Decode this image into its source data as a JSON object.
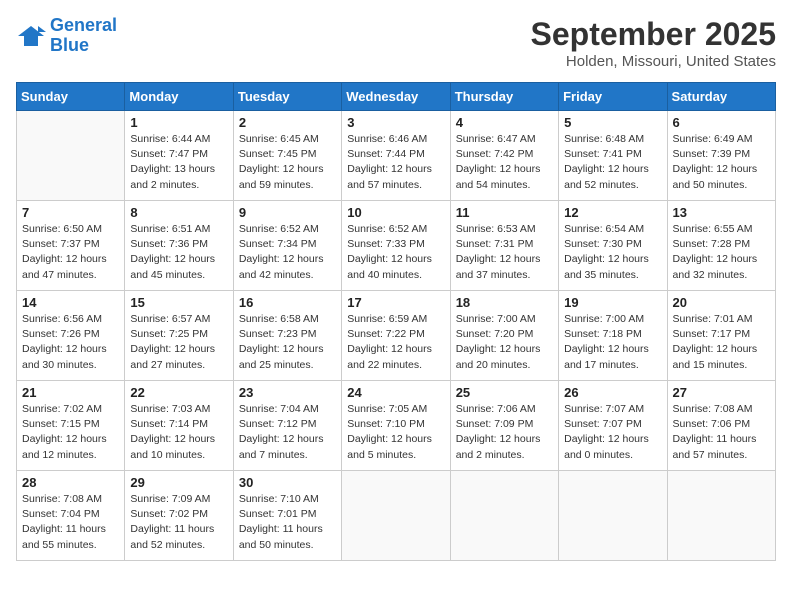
{
  "header": {
    "logo_line1": "General",
    "logo_line2": "Blue",
    "month": "September 2025",
    "location": "Holden, Missouri, United States"
  },
  "weekdays": [
    "Sunday",
    "Monday",
    "Tuesday",
    "Wednesday",
    "Thursday",
    "Friday",
    "Saturday"
  ],
  "weeks": [
    [
      {
        "day": "",
        "info": ""
      },
      {
        "day": "1",
        "info": "Sunrise: 6:44 AM\nSunset: 7:47 PM\nDaylight: 13 hours\nand 2 minutes."
      },
      {
        "day": "2",
        "info": "Sunrise: 6:45 AM\nSunset: 7:45 PM\nDaylight: 12 hours\nand 59 minutes."
      },
      {
        "day": "3",
        "info": "Sunrise: 6:46 AM\nSunset: 7:44 PM\nDaylight: 12 hours\nand 57 minutes."
      },
      {
        "day": "4",
        "info": "Sunrise: 6:47 AM\nSunset: 7:42 PM\nDaylight: 12 hours\nand 54 minutes."
      },
      {
        "day": "5",
        "info": "Sunrise: 6:48 AM\nSunset: 7:41 PM\nDaylight: 12 hours\nand 52 minutes."
      },
      {
        "day": "6",
        "info": "Sunrise: 6:49 AM\nSunset: 7:39 PM\nDaylight: 12 hours\nand 50 minutes."
      }
    ],
    [
      {
        "day": "7",
        "info": "Sunrise: 6:50 AM\nSunset: 7:37 PM\nDaylight: 12 hours\nand 47 minutes."
      },
      {
        "day": "8",
        "info": "Sunrise: 6:51 AM\nSunset: 7:36 PM\nDaylight: 12 hours\nand 45 minutes."
      },
      {
        "day": "9",
        "info": "Sunrise: 6:52 AM\nSunset: 7:34 PM\nDaylight: 12 hours\nand 42 minutes."
      },
      {
        "day": "10",
        "info": "Sunrise: 6:52 AM\nSunset: 7:33 PM\nDaylight: 12 hours\nand 40 minutes."
      },
      {
        "day": "11",
        "info": "Sunrise: 6:53 AM\nSunset: 7:31 PM\nDaylight: 12 hours\nand 37 minutes."
      },
      {
        "day": "12",
        "info": "Sunrise: 6:54 AM\nSunset: 7:30 PM\nDaylight: 12 hours\nand 35 minutes."
      },
      {
        "day": "13",
        "info": "Sunrise: 6:55 AM\nSunset: 7:28 PM\nDaylight: 12 hours\nand 32 minutes."
      }
    ],
    [
      {
        "day": "14",
        "info": "Sunrise: 6:56 AM\nSunset: 7:26 PM\nDaylight: 12 hours\nand 30 minutes."
      },
      {
        "day": "15",
        "info": "Sunrise: 6:57 AM\nSunset: 7:25 PM\nDaylight: 12 hours\nand 27 minutes."
      },
      {
        "day": "16",
        "info": "Sunrise: 6:58 AM\nSunset: 7:23 PM\nDaylight: 12 hours\nand 25 minutes."
      },
      {
        "day": "17",
        "info": "Sunrise: 6:59 AM\nSunset: 7:22 PM\nDaylight: 12 hours\nand 22 minutes."
      },
      {
        "day": "18",
        "info": "Sunrise: 7:00 AM\nSunset: 7:20 PM\nDaylight: 12 hours\nand 20 minutes."
      },
      {
        "day": "19",
        "info": "Sunrise: 7:00 AM\nSunset: 7:18 PM\nDaylight: 12 hours\nand 17 minutes."
      },
      {
        "day": "20",
        "info": "Sunrise: 7:01 AM\nSunset: 7:17 PM\nDaylight: 12 hours\nand 15 minutes."
      }
    ],
    [
      {
        "day": "21",
        "info": "Sunrise: 7:02 AM\nSunset: 7:15 PM\nDaylight: 12 hours\nand 12 minutes."
      },
      {
        "day": "22",
        "info": "Sunrise: 7:03 AM\nSunset: 7:14 PM\nDaylight: 12 hours\nand 10 minutes."
      },
      {
        "day": "23",
        "info": "Sunrise: 7:04 AM\nSunset: 7:12 PM\nDaylight: 12 hours\nand 7 minutes."
      },
      {
        "day": "24",
        "info": "Sunrise: 7:05 AM\nSunset: 7:10 PM\nDaylight: 12 hours\nand 5 minutes."
      },
      {
        "day": "25",
        "info": "Sunrise: 7:06 AM\nSunset: 7:09 PM\nDaylight: 12 hours\nand 2 minutes."
      },
      {
        "day": "26",
        "info": "Sunrise: 7:07 AM\nSunset: 7:07 PM\nDaylight: 12 hours\nand 0 minutes."
      },
      {
        "day": "27",
        "info": "Sunrise: 7:08 AM\nSunset: 7:06 PM\nDaylight: 11 hours\nand 57 minutes."
      }
    ],
    [
      {
        "day": "28",
        "info": "Sunrise: 7:08 AM\nSunset: 7:04 PM\nDaylight: 11 hours\nand 55 minutes."
      },
      {
        "day": "29",
        "info": "Sunrise: 7:09 AM\nSunset: 7:02 PM\nDaylight: 11 hours\nand 52 minutes."
      },
      {
        "day": "30",
        "info": "Sunrise: 7:10 AM\nSunset: 7:01 PM\nDaylight: 11 hours\nand 50 minutes."
      },
      {
        "day": "",
        "info": ""
      },
      {
        "day": "",
        "info": ""
      },
      {
        "day": "",
        "info": ""
      },
      {
        "day": "",
        "info": ""
      }
    ]
  ]
}
